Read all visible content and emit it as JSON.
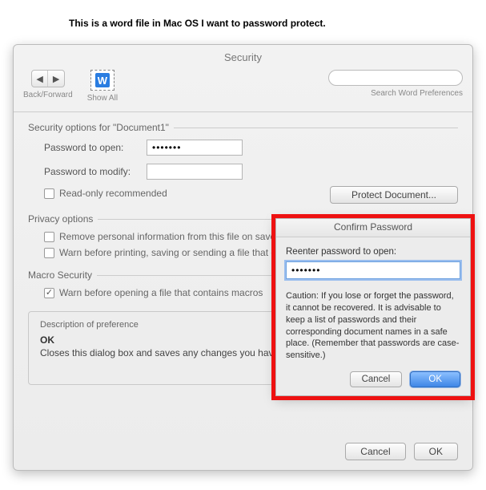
{
  "caption": "This is a word file in Mac OS I want to password protect.",
  "window": {
    "title": "Security",
    "toolbar": {
      "back_forward_label": "Back/Forward",
      "show_all_label": "Show All",
      "search_placeholder": "",
      "search_sublabel": "Search Word Preferences"
    },
    "sections": {
      "security_options_head": "Security options for \"Document1\"",
      "password_open_label": "Password to open:",
      "password_open_value": "•••••••",
      "password_modify_label": "Password to modify:",
      "password_modify_value": "",
      "readonly_label": "Read-only recommended",
      "protect_button": "Protect Document...",
      "privacy_head": "Privacy options",
      "privacy_remove_label": "Remove personal information from this file on save",
      "privacy_warn_label": "Warn before printing, saving or sending a file that contains tracked changes or comments",
      "macro_head": "Macro Security",
      "macro_warn_label": "Warn before opening a file that contains macros"
    },
    "description": {
      "head": "Description of preference",
      "ok": "OK",
      "body": "Closes this dialog box and saves any changes you have made."
    },
    "footer": {
      "cancel": "Cancel",
      "ok": "OK"
    }
  },
  "dialog": {
    "title": "Confirm Password",
    "label": "Reenter password to open:",
    "value": "•••••••",
    "caution": "Caution: If you lose or forget the password, it cannot be recovered. It is advisable to keep a list of passwords and their corresponding document names in a safe place. (Remember that passwords are case-sensitive.)",
    "cancel": "Cancel",
    "ok": "OK"
  }
}
